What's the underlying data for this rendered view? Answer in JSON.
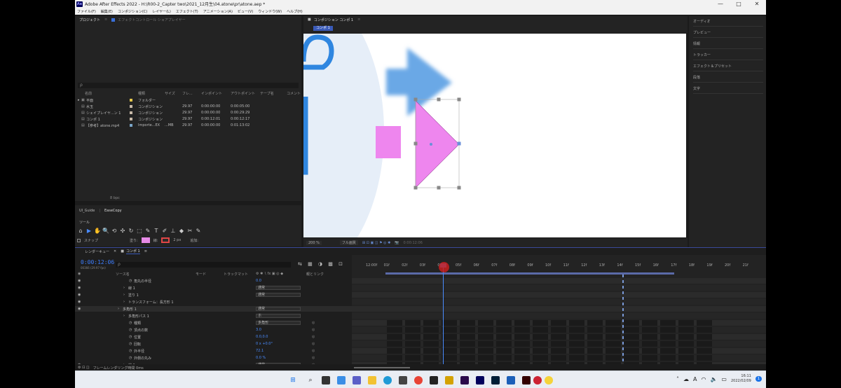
{
  "window": {
    "title": "Adobe After Effects 2022 - H:\\R00-2_Capter two\\2021_12月生\\04.atone\\pr\\atone.aep *",
    "app_badge": "Ae",
    "min": "—",
    "max": "□",
    "close": "✕"
  },
  "menu": [
    "ファイル(F)",
    "編集(E)",
    "コンポジション(C)",
    "レイヤー(L)",
    "エフェクト(T)",
    "アニメーション(A)",
    "ビュー(V)",
    "ウィンドウ(W)",
    "ヘルプ(H)"
  ],
  "project_panel": {
    "tab": "プロジェクト",
    "tab2": "エフェクトコントロール ショアプレイヤー",
    "search_placeholder": "ρ",
    "columns": [
      "名前",
      "種類",
      "サイズ",
      "フレ...",
      "インポイント",
      "アウトポイント",
      "テープ名",
      "コメント"
    ],
    "items": [
      {
        "name": "平面",
        "type": "フォルダー",
        "size": "",
        "fps": "",
        "in": "",
        "out": "",
        "color": "#e3c64a"
      },
      {
        "name": "水玉",
        "type": "コンポジション",
        "size": "",
        "fps": "29.97",
        "in": "0:00:00:00",
        "out": "0:00:05:00",
        "color": "#c8b9a8"
      },
      {
        "name": "シェイプレイヤ...ン 1",
        "type": "コンポジション",
        "size": "",
        "fps": "29.97",
        "in": "0:00:00:00",
        "out": "0:00:29:29",
        "color": "#c8b9a8"
      },
      {
        "name": "コンポ 1",
        "type": "コンポジション",
        "size": "",
        "fps": "29.97",
        "in": "0:00:12:01",
        "out": "0:00:12:17",
        "color": "#c8b9a8"
      },
      {
        "name": "【参考】atone.mp4",
        "type": "Importe...EX",
        "size": "...MB",
        "fps": "29.97",
        "in": "0:00:00:00",
        "out": "0:01:13:02",
        "color": "#7aa5c8"
      }
    ],
    "footer": "8 bpc"
  },
  "fx_panel": {
    "tab1": "UI_Guide",
    "tab2": "EaseCopy"
  },
  "tools_panel": {
    "title": "ツール",
    "icons": [
      "⌂",
      "▶",
      "✋",
      "🔍",
      "⟲",
      "✣",
      "↻",
      "⬚",
      "✎",
      "T",
      "✐",
      "⊥",
      "◆",
      "✂",
      "✎"
    ],
    "snap_label": "スナップ",
    "fill_label": "塗り:",
    "stroke_label": "線:",
    "stroke_width": "2 px",
    "add_label": "追加:",
    "fill_color": "#e68ae6",
    "stroke_color": "#e04646"
  },
  "composition": {
    "tab": "コンポジション コンポ 1",
    "subtab": "コンポ 1",
    "zoom": "200 %",
    "quality": "フル画質",
    "timecode": "0:00:12:06",
    "shape_color": "#ee86ee",
    "blur_color": "#6aa8e6",
    "bg_color": "#ffffff"
  },
  "right_panel": [
    "オーディオ",
    "プレビュー",
    "情報",
    "トラッカー",
    "エフェクト＆プリセット",
    "段落",
    "文字"
  ],
  "timeline": {
    "tabs": [
      "レンダーキュー",
      "コンポ 1"
    ],
    "timecode": "0:00:12:06",
    "timecode_sub": "00366 (29.97 fps)",
    "search_placeholder": "ρ",
    "columns": [
      "ソース名",
      "モード",
      "トラックマット",
      "親とリンク"
    ],
    "layers": [
      {
        "indent": 3,
        "name": "角丸の半径",
        "value": "0.0",
        "select": ""
      },
      {
        "indent": 2,
        "name": "線 1",
        "value": "",
        "select": "通常"
      },
      {
        "indent": 2,
        "name": "塗り 1",
        "value": "",
        "select": "通常"
      },
      {
        "indent": 2,
        "name": "トランスフォーム：長方形 1",
        "value": "",
        "select": ""
      },
      {
        "indent": 1,
        "name": "多角形 1",
        "value": "",
        "select": "通常"
      },
      {
        "indent": 2,
        "name": "多角形パス 1",
        "value": "",
        "select": "ホ"
      },
      {
        "indent": 3,
        "name": "種類",
        "value": "",
        "select": "多角形"
      },
      {
        "indent": 3,
        "name": "頂点の数",
        "value": "3.0",
        "select": ""
      },
      {
        "indent": 3,
        "name": "位置",
        "value": "0.0,0.0",
        "select": ""
      },
      {
        "indent": 3,
        "name": "回転",
        "value": "0 x +0.0°",
        "select": ""
      },
      {
        "indent": 3,
        "name": "外半径",
        "value": "72.1",
        "select": ""
      },
      {
        "indent": 3,
        "name": "外側の丸み",
        "value": "0.0 %",
        "select": ""
      },
      {
        "indent": 2,
        "name": "線 1",
        "value": "",
        "select": "通常"
      }
    ],
    "ruler": [
      "12:00f",
      "01f",
      "02f",
      "03f",
      "04f",
      "05f",
      "06f",
      "07f",
      "08f",
      "09f",
      "10f",
      "11f",
      "12f",
      "13f",
      "14f",
      "15f",
      "16f",
      "17f",
      "18f",
      "19f",
      "20f",
      "21f"
    ],
    "footer": "フレームレンダリング時間  0ms"
  },
  "taskbar": {
    "time": "16:11",
    "date": "2022/02/09",
    "notif": "1"
  }
}
